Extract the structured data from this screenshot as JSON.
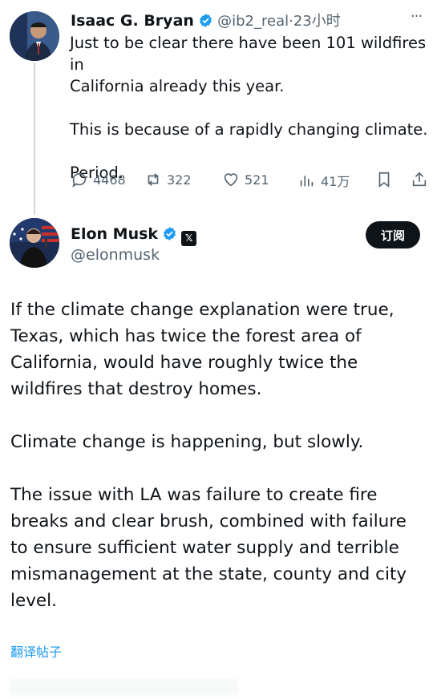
{
  "reply_tweet": {
    "author_name": "Isaac G. Bryan",
    "handle": "@ib2_real",
    "time": "·23小时",
    "more": "···",
    "text": "Just to be clear there have been 101 wildfires in\nCalifornia already this year.\n\nThis is because of a rapidly changing climate.\n\nPeriod.",
    "stats": {
      "replies": "4468",
      "reposts": "322",
      "likes": "521",
      "views": "41万"
    }
  },
  "main_tweet": {
    "author_name": "Elon Musk",
    "handle": "@elonmusk",
    "subscribe_label": "订阅",
    "affiliate_badge": "𝕏",
    "text": "If the climate change explanation were true,\nTexas, which has twice the forest area of\nCalifornia, would have roughly twice the\nwildfires that destroy homes.\n\nClimate change is happening, but slowly.\n\nThe issue with LA was failure to create fire\nbreaks and clear brush, combined with failure\nto ensure sufficient water supply and terrible\nmismanagement at the state, county and city\nlevel.",
    "translate_label": "翻译帖子"
  },
  "colors": {
    "accent": "#1d9bf0",
    "verified": "#1d9bf0",
    "text": "#0f1419",
    "muted": "#536471"
  }
}
